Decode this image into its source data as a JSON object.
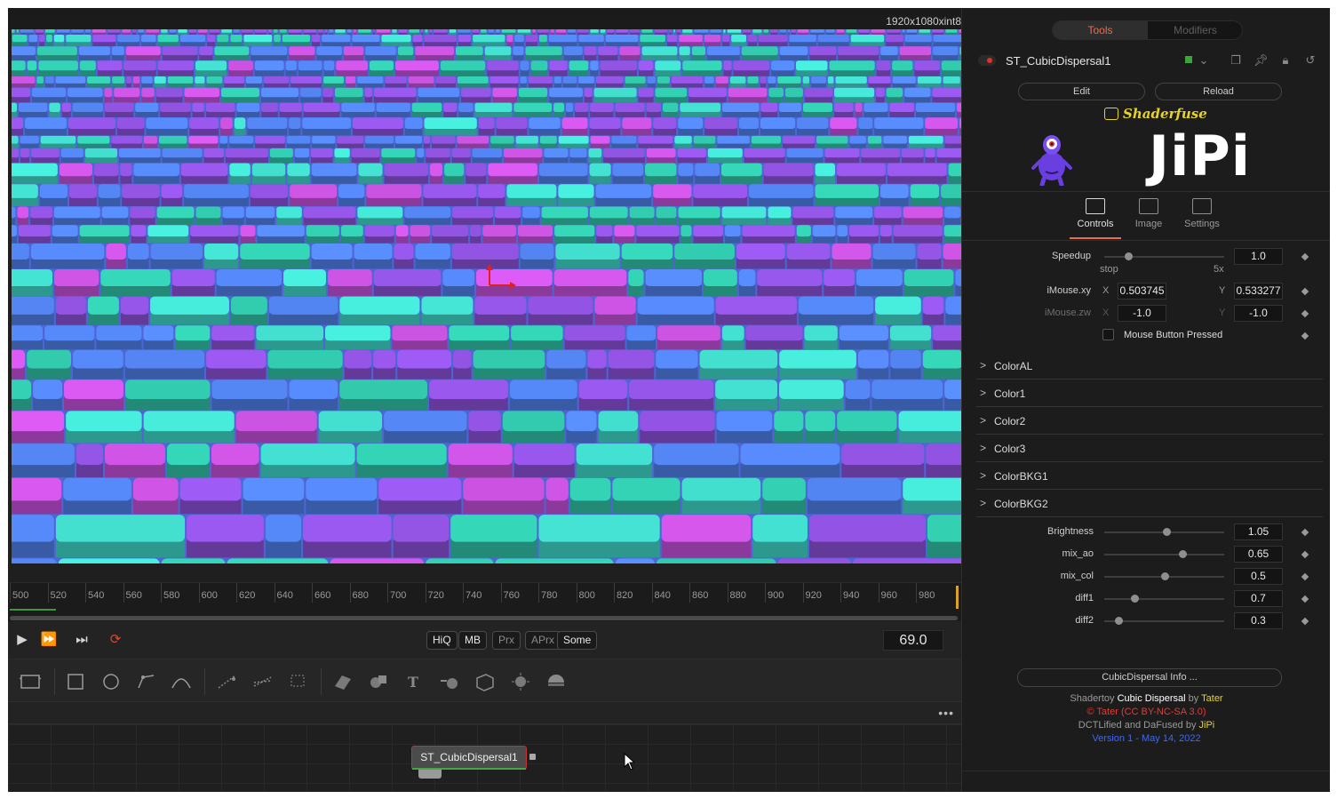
{
  "viewer": {
    "resolution": "1920x1080xint8",
    "colors": {
      "purple": "#8a4fd6",
      "cyan": "#3fd3c4",
      "blue": "#4f7ee6",
      "magenta": "#c14fd6",
      "teal": "#2fbfa4"
    }
  },
  "timeline": {
    "ticks": [
      "500",
      "520",
      "540",
      "560",
      "580",
      "600",
      "620",
      "640",
      "660",
      "680",
      "700",
      "720",
      "740",
      "760",
      "780",
      "800",
      "820",
      "840",
      "860",
      "880",
      "900",
      "920",
      "940",
      "960",
      "980"
    ]
  },
  "transport": {
    "play_icon": "play-icon",
    "fast_forward_icon": "fast-forward-icon",
    "skip_end_icon": "skip-end-icon",
    "loop_icon": "loop-icon",
    "hiq": "HiQ",
    "mb": "MB",
    "prx": "Prx",
    "aprx": "APrx",
    "some": "Some",
    "frame": "69.0"
  },
  "node_bar": {
    "more": "•••"
  },
  "flow": {
    "node_name": "ST_CubicDispersal1"
  },
  "inspector": {
    "tabs": {
      "tools": "Tools",
      "modifiers": "Modifiers"
    },
    "node_title": "ST_CubicDispersal1",
    "header_icons": [
      "pin-window-icon",
      "pin-icon",
      "lock-icon",
      "reset-icon"
    ],
    "edit": "Edit",
    "reload": "Reload",
    "shaderfuse": "Shaderfuse",
    "jipi": "JiPi",
    "panel_tabs": {
      "controls": "Controls",
      "image": "Image",
      "settings": "Settings"
    },
    "speedup": {
      "label": "Speedup",
      "value": "1.0",
      "min_label": "stop",
      "max_label": "5x",
      "fraction": 0.2
    },
    "imouse_xy": {
      "label": "iMouse.xy",
      "x_label": "X",
      "x": "0.503745",
      "y_label": "Y",
      "y": "0.533277"
    },
    "imouse_zw": {
      "label": "iMouse.zw",
      "x_label": "X",
      "x": "-1.0",
      "y_label": "Y",
      "y": "-1.0"
    },
    "mouse_button": "Mouse Button Pressed",
    "groups": [
      "ColorAL",
      "Color1",
      "Color2",
      "Color3",
      "ColorBKG1",
      "ColorBKG2"
    ],
    "sliders": [
      {
        "label": "Brightness",
        "value": "1.05",
        "fraction": 0.52
      },
      {
        "label": "mix_ao",
        "value": "0.65",
        "fraction": 0.65
      },
      {
        "label": "mix_col",
        "value": "0.5",
        "fraction": 0.5
      },
      {
        "label": "diff1",
        "value": "0.7",
        "fraction": 0.25
      },
      {
        "label": "diff2",
        "value": "0.3",
        "fraction": 0.12
      }
    ],
    "info_button": "CubicDispersal Info ...",
    "credits": {
      "l1_a": "Shadertoy ",
      "l1_b": "Cubic Dispersal",
      "l1_c": " by ",
      "l1_d": "Tater",
      "l2": "© Tater (CC BY-NC-SA 3.0)",
      "l3_a": "DCTLified and DaFused by ",
      "l3_b": "JiPi",
      "l4": "Version 1 - May 14, 2022"
    }
  }
}
